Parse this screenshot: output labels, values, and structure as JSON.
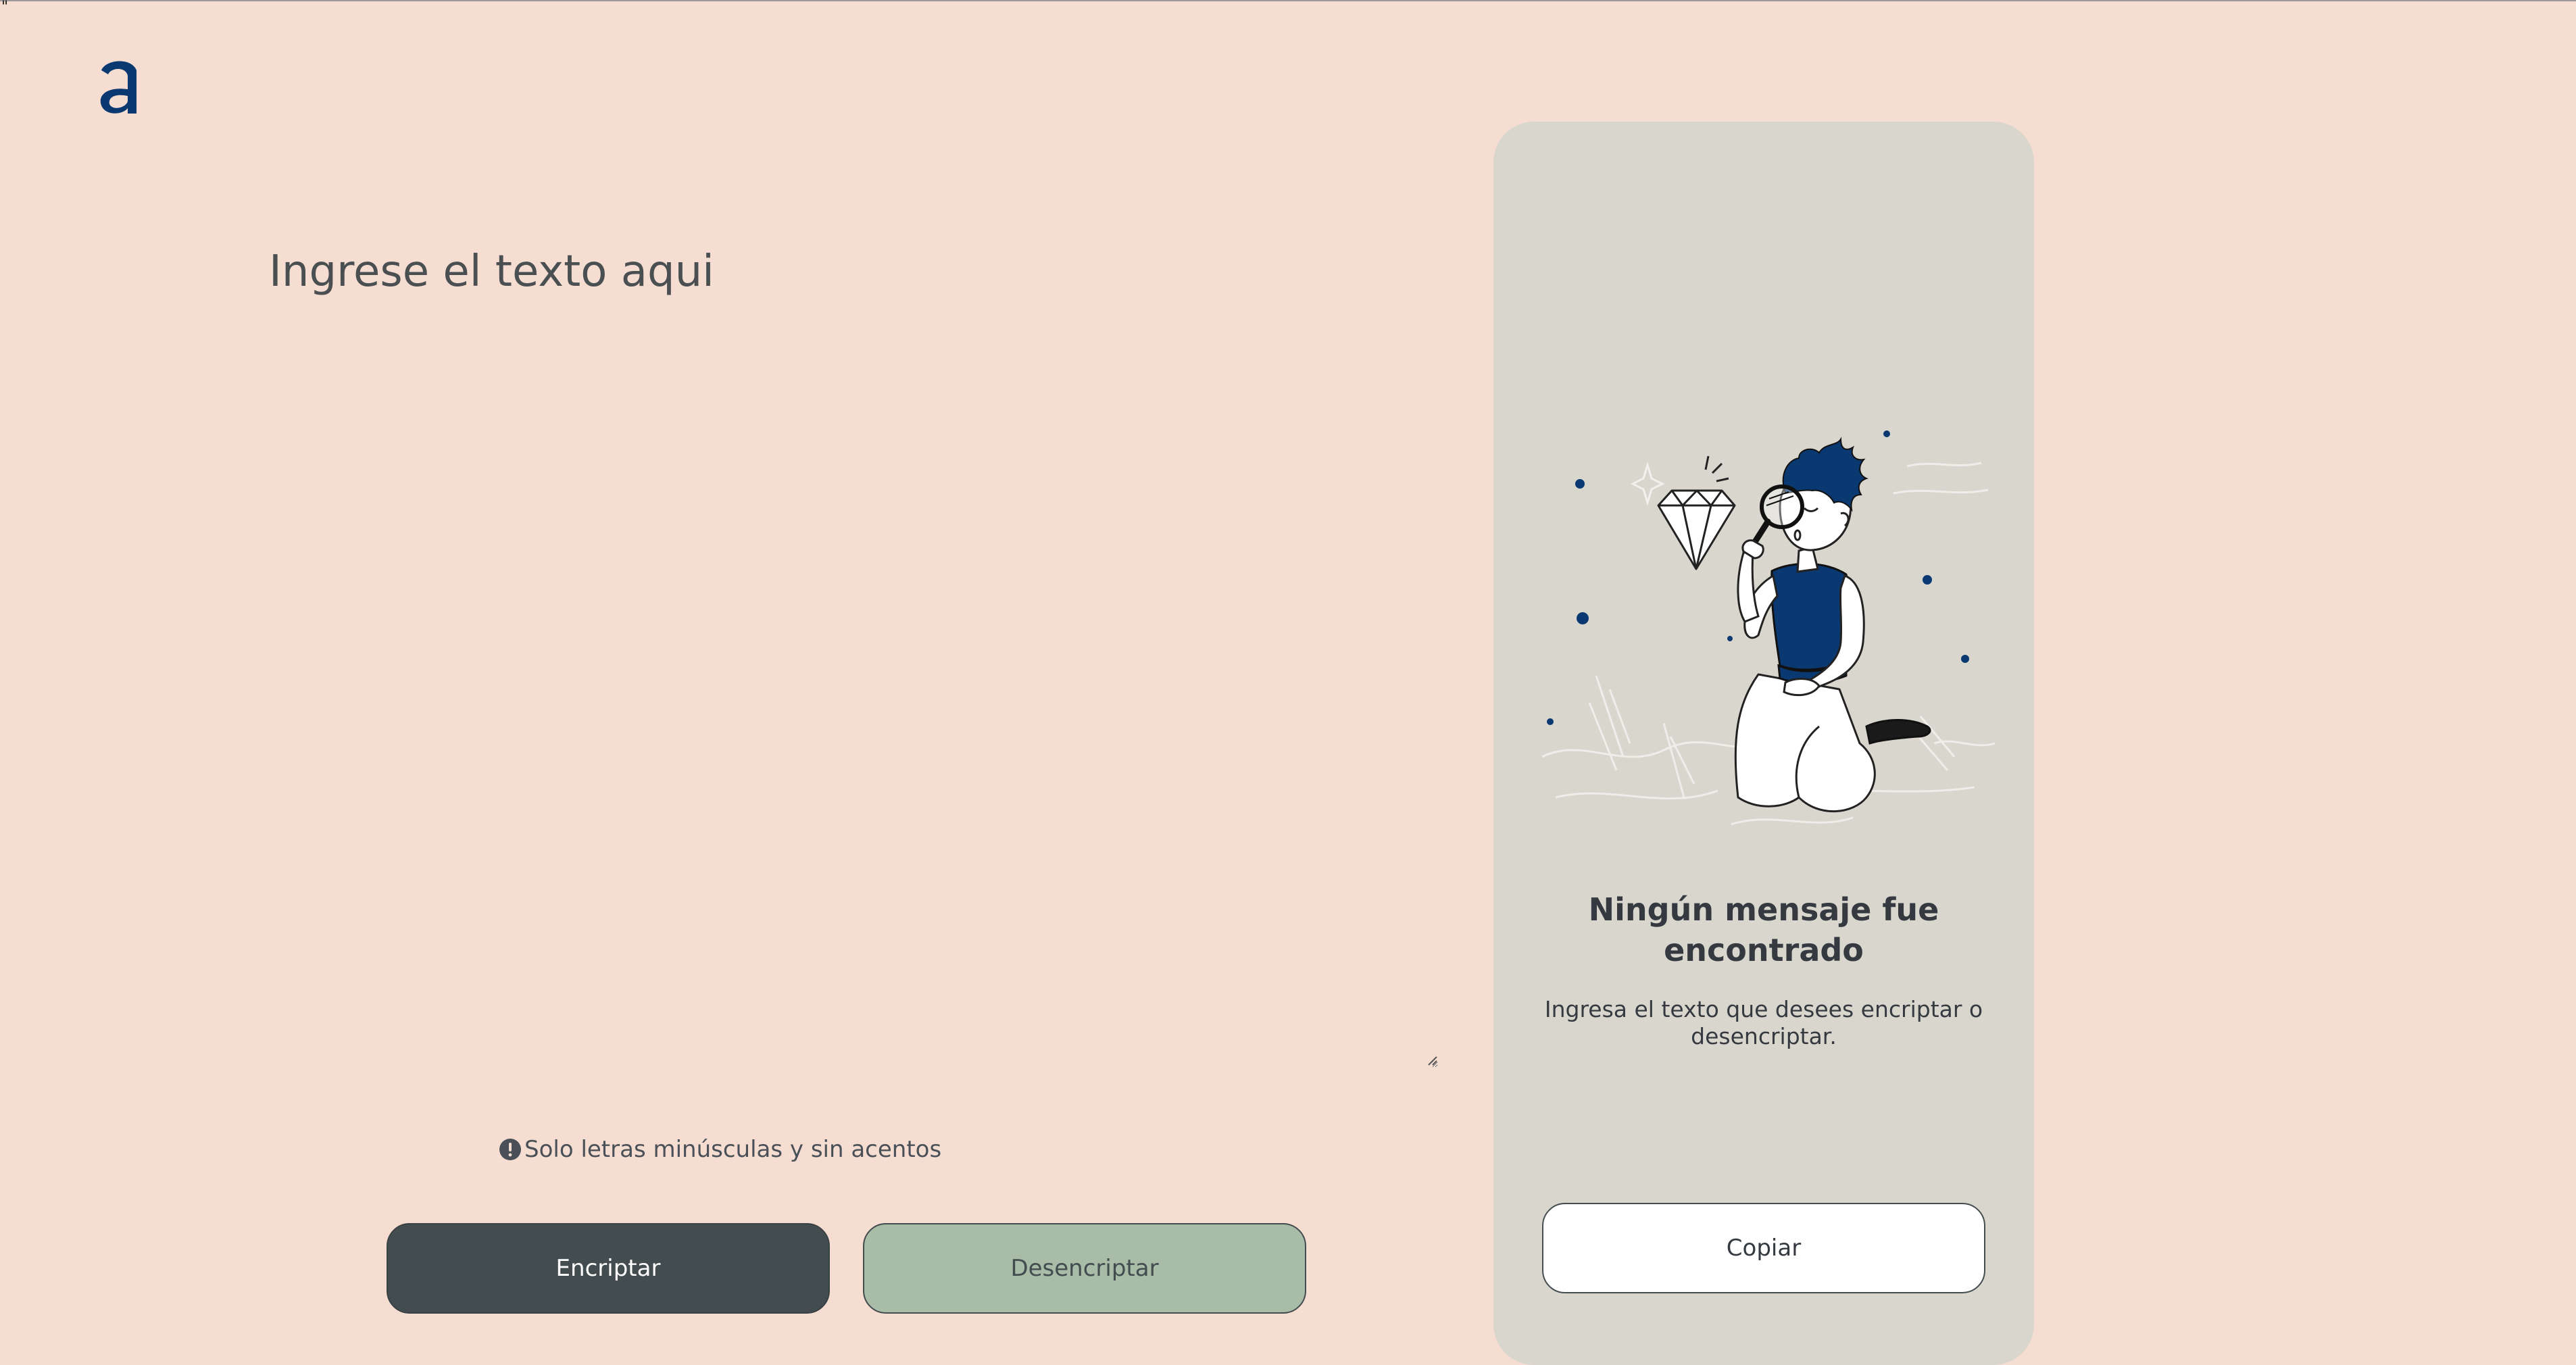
{
  "colors": {
    "background": "#F6DDD2",
    "brand": "#0A3871",
    "panel": "#D9D6CE",
    "encrypt_button": "#434C4F",
    "decrypt_button": "#A8BCA8",
    "text": "#343A40"
  },
  "header": {
    "stray_char": "\"",
    "logo_icon": "alura-a-logo"
  },
  "editor": {
    "placeholder": "Ingrese el texto aqui",
    "value": "",
    "hint_icon": "exclamation-circle-icon",
    "hint": "Solo letras minúsculas y sin acentos"
  },
  "actions": {
    "encrypt_label": "Encriptar",
    "decrypt_label": "Desencriptar"
  },
  "output": {
    "illustration_icon": "person-with-magnifier-and-diamond-illustration",
    "empty_title_line1": "Ningún mensaje fue",
    "empty_title_line2": "encontrado",
    "empty_desc_line1": "Ingresa el texto que desees encriptar o",
    "empty_desc_line2": "desencriptar.",
    "copy_label": "Copiar"
  }
}
